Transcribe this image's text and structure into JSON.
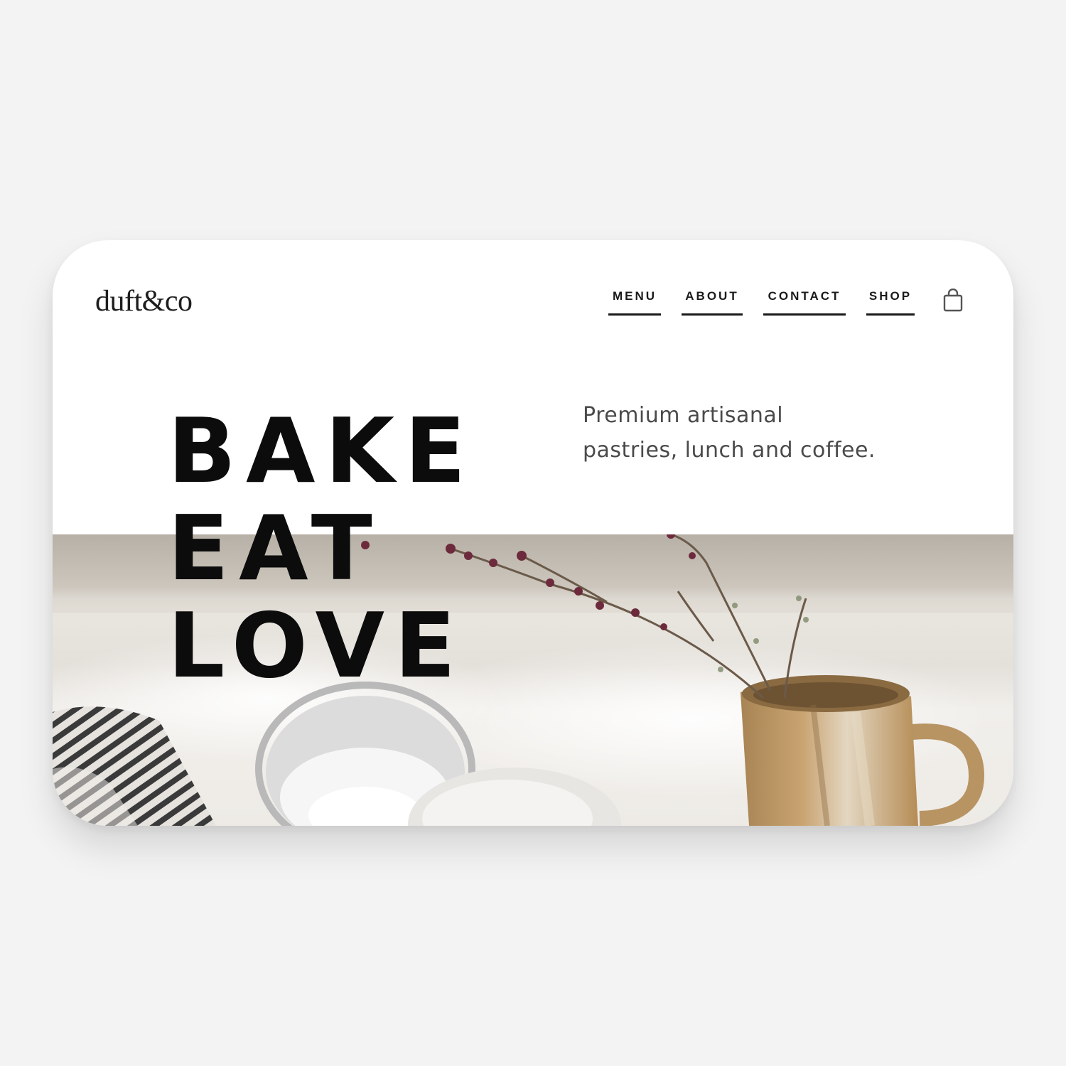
{
  "brand": {
    "logo_text": "duft&co"
  },
  "nav": {
    "items": [
      {
        "label": "MENU"
      },
      {
        "label": "ABOUT"
      },
      {
        "label": "CONTACT"
      },
      {
        "label": "SHOP"
      }
    ],
    "cart_icon": "shopping-bag-icon"
  },
  "hero": {
    "headline": [
      "BAKE",
      "EAT",
      "LOVE"
    ],
    "tagline_lines": [
      "Premium artisanal",
      "pastries, lunch and coffee."
    ],
    "image": "kitchen still life: ceramic jug with dried flower branches, sieve, striped cloth"
  },
  "colors": {
    "background": "#f3f3f3",
    "card": "#ffffff",
    "text": "#0c0c0c",
    "muted": "#4a4a4a"
  }
}
